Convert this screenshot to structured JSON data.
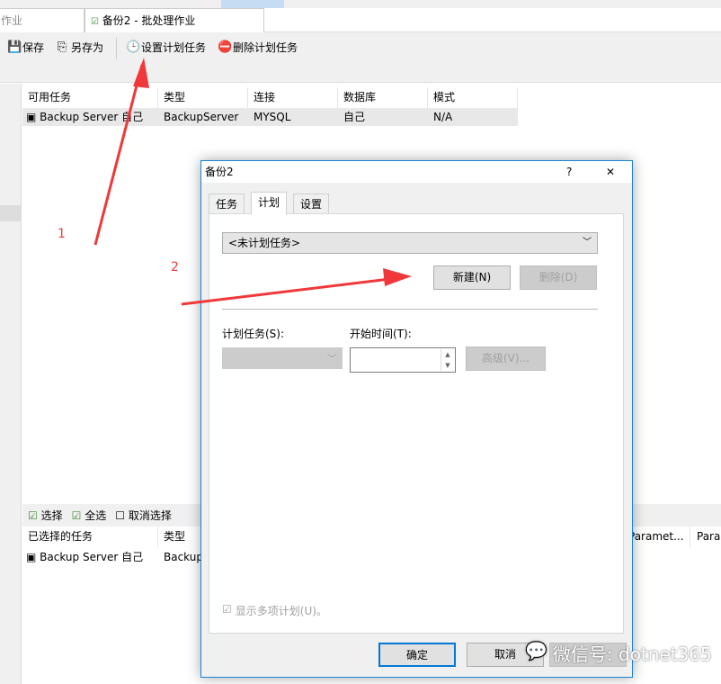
{
  "document_tabs": [
    {
      "label": "作业"
    },
    {
      "label": "备份2 - 批处理作业"
    }
  ],
  "toolbar": {
    "save": "保存",
    "save_as": "另存为",
    "set_schedule": "设置计划任务",
    "delete_schedule": "删除计划任务"
  },
  "available_tasks": {
    "columns": [
      "可用任务",
      "类型",
      "连接",
      "数据库",
      "模式"
    ],
    "rows": [
      [
        "Backup Server 自己",
        "BackupServer",
        "MYSQL",
        "自己",
        "N/A"
      ]
    ]
  },
  "selection_toolbar": {
    "select": "选择",
    "select_all": "全选",
    "deselect": "取消选择"
  },
  "selected_tasks": {
    "columns": [
      "已选择的任务",
      "类型",
      "Paramet...",
      "Paramete"
    ],
    "rows": [
      [
        "Backup Server 自己",
        "Backup"
      ]
    ]
  },
  "annotations": {
    "step1": "1",
    "step2": "2",
    "arrow_color": "#f0383a"
  },
  "dialog": {
    "title": "备份2",
    "help": "?",
    "close": "✕",
    "tabs": [
      "任务",
      "计划",
      "设置"
    ],
    "active_tab": "计划",
    "schedule_select": "<未计划任务>",
    "new_button": "新建(N)",
    "delete_button": "删除(D)",
    "schedule_task_label": "计划任务(S):",
    "start_time_label": "开始时间(T):",
    "advanced_button": "高级(V)...",
    "show_multiple": "显示多项计划(U)。",
    "show_multiple_checked": true,
    "ok": "确定",
    "cancel": "取消"
  },
  "watermark": "微信号: dotnet365"
}
